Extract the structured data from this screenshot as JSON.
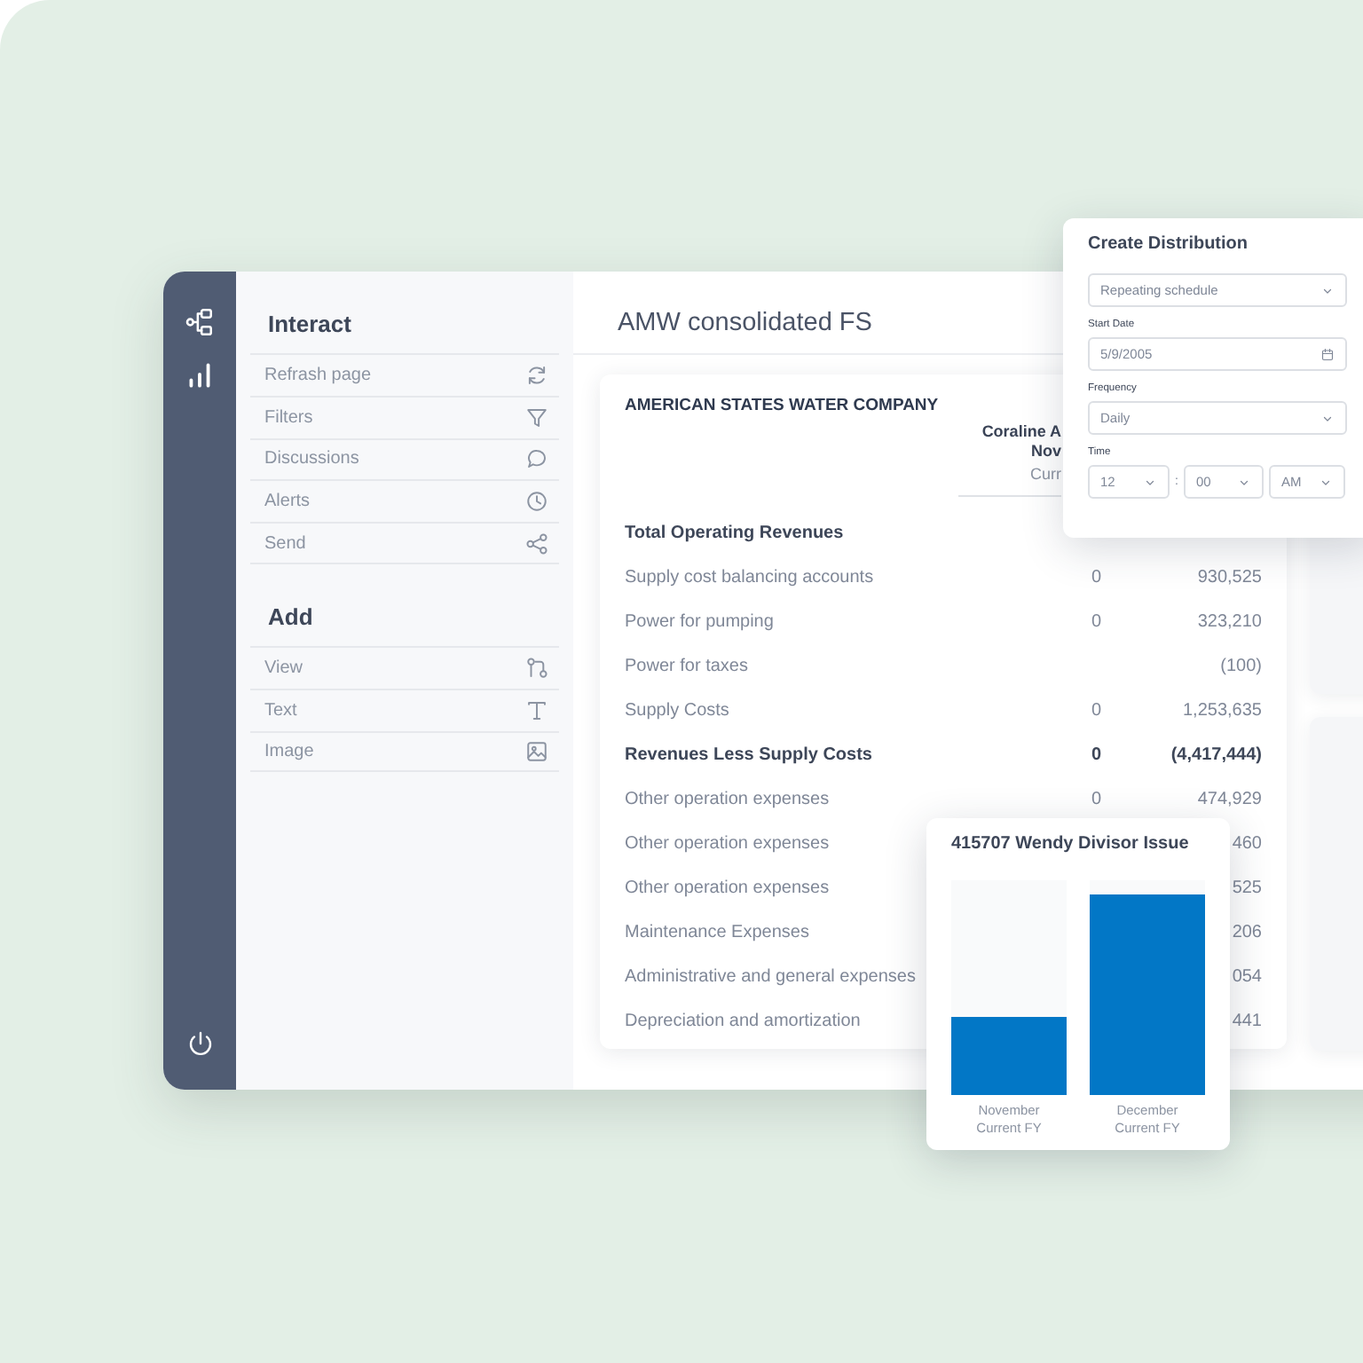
{
  "panel": {
    "sections": [
      {
        "title": "Interact",
        "items": [
          "Refrash page",
          "Filters",
          "Discussions",
          "Alerts",
          "Send"
        ]
      },
      {
        "title": "Add",
        "items": [
          "View",
          "Text",
          "Image"
        ]
      }
    ]
  },
  "report": {
    "title": "AMW consolidated FS",
    "company": "AMERICAN STATES WATER COMPANY",
    "column_header": [
      "Coraline A",
      "Nov",
      "Curr"
    ],
    "rows": [
      {
        "label": "Total Operating Revenues",
        "bold": true
      },
      {
        "label": "Supply cost balancing accounts",
        "bold": false,
        "column_1": "0",
        "column_2": "930,525"
      },
      {
        "label": "Power for pumping",
        "bold": false,
        "column_1": "0",
        "column_2": "323,210"
      },
      {
        "label": "Power for taxes",
        "bold": false,
        "column_2": "(100)"
      },
      {
        "label": "Supply Costs",
        "bold": false,
        "column_1": "0",
        "column_2": "1,253,635"
      },
      {
        "label": "Revenues Less Supply Costs",
        "bold": true,
        "column_1": "0",
        "column_2": "(4,417,444)"
      },
      {
        "label": "Other operation expenses",
        "bold": false,
        "column_1": "0",
        "column_2": "474,929"
      },
      {
        "label": "Other operation expenses",
        "bold": false,
        "column_2": "460"
      },
      {
        "label": "Other operation expenses",
        "bold": false,
        "column_2": "525"
      },
      {
        "label": "Maintenance Expenses",
        "bold": false,
        "column_2": "206"
      },
      {
        "label": "Administrative and general expenses",
        "bold": false,
        "column_2": "054"
      },
      {
        "label": "Depreciation and amortization",
        "bold": false,
        "column_2": "441"
      }
    ]
  },
  "distribution": {
    "title": "Create Distribution",
    "schedule": "Repeating schedule",
    "start_date": {
      "label": "Start Date",
      "value": "5/9/2005"
    },
    "frequency": {
      "label": "Frequency",
      "value": "Daily"
    },
    "time": {
      "label": "Time",
      "hour": "12",
      "separator": ":",
      "minute": "00",
      "period": "AM"
    }
  },
  "chart_popup": {
    "title": "415707 Wendy Divisor Issue",
    "bars": [
      {
        "label": "November",
        "sublabel": "Current FY",
        "level": 0.36
      },
      {
        "label": "December",
        "sublabel": "Current FY",
        "level": 0.93
      }
    ]
  }
}
